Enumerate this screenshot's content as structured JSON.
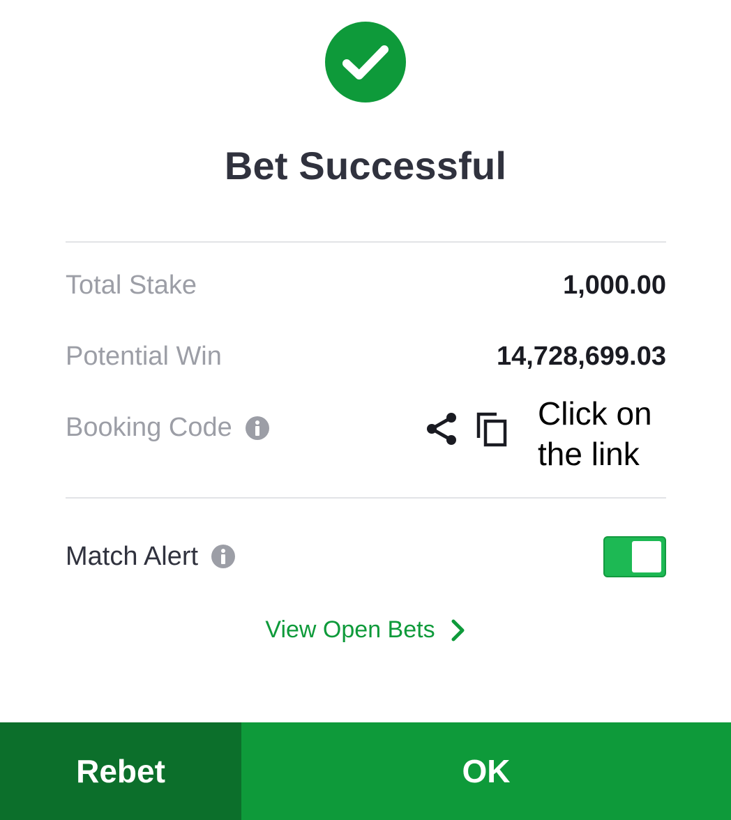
{
  "header": {
    "icon": "check-circle-icon",
    "title": "Bet Successful"
  },
  "details": {
    "total_stake_label": "Total Stake",
    "total_stake_value": "1,000.00",
    "potential_win_label": "Potential Win",
    "potential_win_value": "14,728,699.03",
    "booking_code_label": "Booking Code",
    "booking_note": "Click on the link"
  },
  "match_alert": {
    "label": "Match Alert",
    "enabled": true
  },
  "view_open_bets": "View Open Bets",
  "footer": {
    "rebet_label": "Rebet",
    "ok_label": "OK"
  },
  "colors": {
    "brand_green": "#0e9a3a",
    "dark_green": "#0c6f2b",
    "toggle_green": "#1db954",
    "title_text": "#30323e",
    "muted_text": "#9c9ea6"
  }
}
